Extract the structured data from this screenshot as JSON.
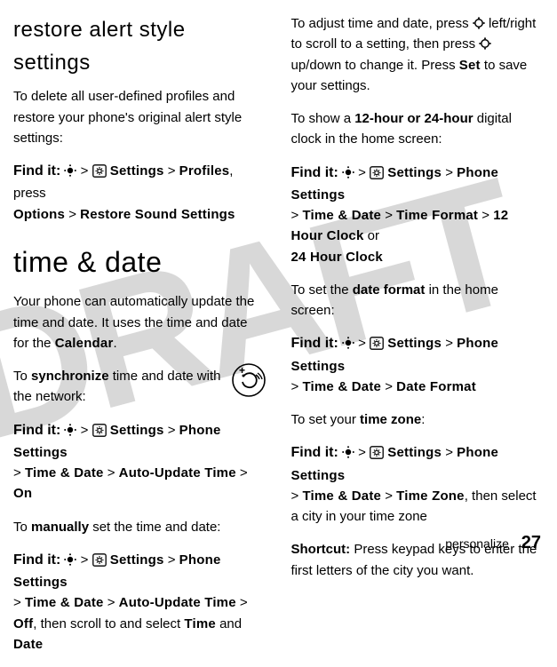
{
  "watermark": "DRAFT",
  "left": {
    "h1": "restore alert style settings",
    "p1": "To delete all user-defined profiles and restore your phone's original alert style settings:",
    "find1_pre": "Find it:",
    "find1_a": "Settings",
    "find1_b": "Profiles",
    "find1_c": ", press ",
    "find1_d": "Options",
    "find1_e": "Restore Sound Settings",
    "h2": "time & date",
    "p2a": "Your phone can automatically update the time and date. It uses the time and date for the ",
    "p2b": "Calendar",
    "p2c": ".",
    "p3a": "To ",
    "p3b": "synchronize",
    "p3c": " time and date with the network:",
    "find2_path": [
      "Settings",
      "Phone Settings",
      "Time & Date",
      "Auto-Update Time",
      "On"
    ],
    "p4a": "To ",
    "p4b": "manually",
    "p4c": " set the time and date:",
    "find3_path": [
      "Settings",
      "Phone Settings",
      "Time & Date",
      "Auto-Update Time",
      "Off"
    ],
    "find3_tail1": ", then scroll to and select ",
    "find3_tail2": "Time",
    "find3_tail3": " and ",
    "find3_tail4": "Date"
  },
  "right": {
    "p1a": "To adjust time and date, press ",
    "p1b": " left/right to scroll to a setting, then press ",
    "p1c": " up/down to change it. Press ",
    "p1d": "Set",
    "p1e": " to save your settings.",
    "p2a": "To show a ",
    "p2b": "12-hour or 24-hour",
    "p2c": " digital clock in the home screen:",
    "find4_path": [
      "Settings",
      "Phone Settings",
      "Time & Date",
      "Time Format",
      "12 Hour Clock"
    ],
    "find4_or": " or ",
    "find4_alt": "24 Hour Clock",
    "p3a": "To set the ",
    "p3b": "date format",
    "p3c": " in the home screen:",
    "find5_path": [
      "Settings",
      "Phone Settings",
      "Time & Date",
      "Date Format"
    ],
    "p4a": "To set your ",
    "p4b": "time zone",
    "p4c": ":",
    "find6_path": [
      "Settings",
      "Phone Settings",
      "Time & Date",
      "Time Zone"
    ],
    "find6_tail": ", then select a city in your time zone",
    "p5a": "Shortcut:",
    "p5b": " Press keypad keys to enter the first letters of the city you want."
  },
  "footer": {
    "section": "personalize",
    "page": "27"
  }
}
